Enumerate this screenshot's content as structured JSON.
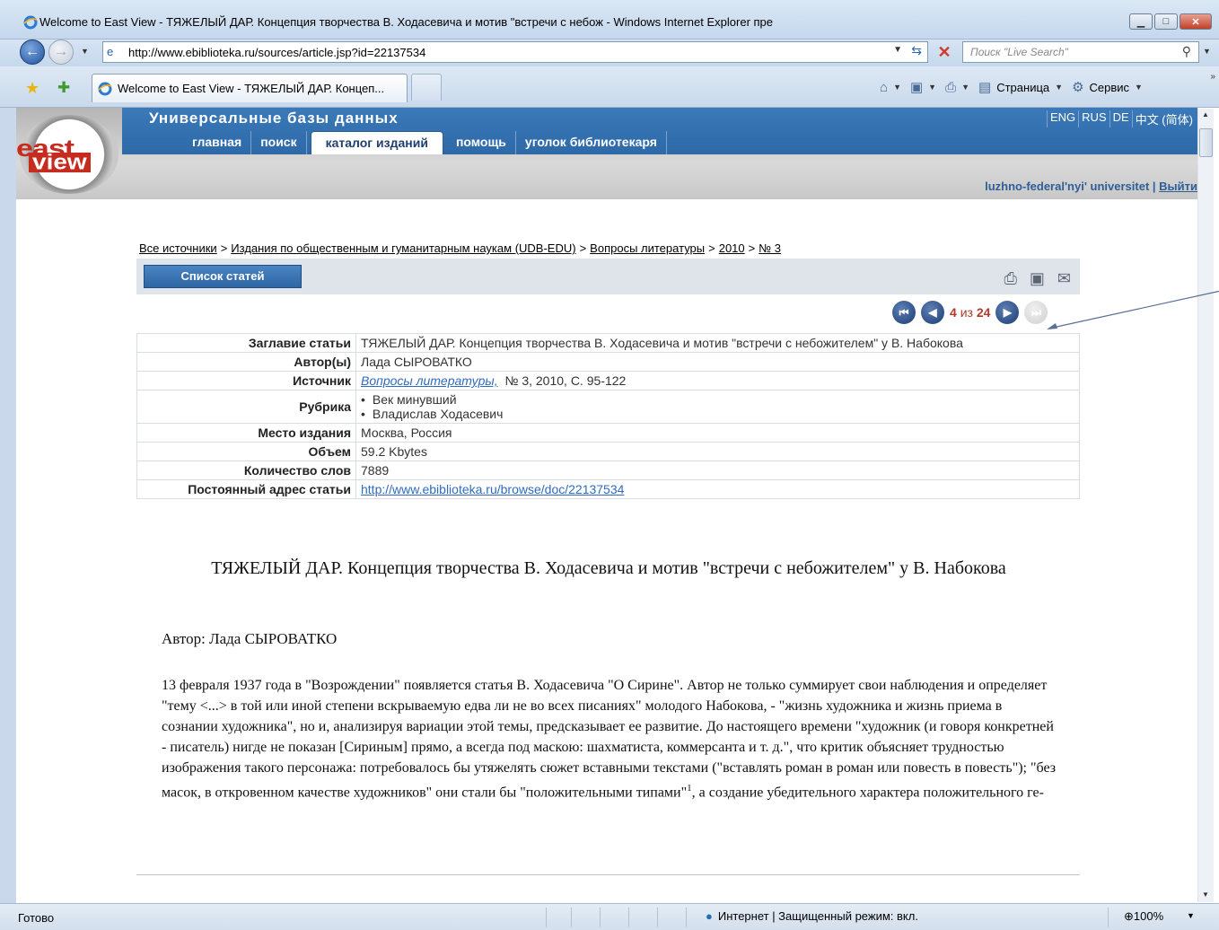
{
  "window": {
    "title": "Welcome to East View - ТЯЖЕЛЫЙ ДАР. Концепция творчества В. Ходасевича и мотив \"встречи с небож - Windows Internet Explorer пре",
    "address": "http://www.ebiblioteka.ru/sources/article.jsp?id=22137534",
    "search_placeholder": "Поиск \"Live Search\"",
    "tab_title": "Welcome to East View - ТЯЖЕЛЫЙ ДАР. Концеп...",
    "commands": {
      "page": "Страница",
      "tools": "Сервис"
    }
  },
  "site": {
    "title": "Универсальные базы данных",
    "languages": [
      "ENG",
      "RUS",
      "DE",
      "中文 (简体)"
    ],
    "nav": [
      "главная",
      "поиск",
      "каталог изданий",
      "помощь",
      "уголок библиотекаря"
    ],
    "active_nav": "каталог изданий",
    "user": "luzhno-federal'nyi' universitet",
    "logout": "Выйти",
    "logo": {
      "east": "east",
      "view": "view"
    }
  },
  "breadcrumb": [
    "Все источники",
    "Издания по общественным и гуманитарным наукам (UDB-EDU)",
    "Вопросы литературы",
    "2010",
    "№ 3"
  ],
  "toolbar": {
    "list_button": "Список статей"
  },
  "pager": {
    "current": "4",
    "of": "из",
    "total": "24"
  },
  "info": {
    "title_label": "Заглавие статьи",
    "title_value": "ТЯЖЕЛЫЙ ДАР. Концепция творчества В. Ходасевича и мотив \"встречи с небожителем\" у В. Набокова",
    "author_label": "Автор(ы)",
    "author_value": "Лада СЫРОВАТКО",
    "source_label": "Источник",
    "source_link": "Вопросы литературы,",
    "source_rest": "№ 3, 2010, C. 95-122",
    "rubric_label": "Рубрика",
    "rubric_items": [
      "Век минувший",
      "Владислав Ходасевич"
    ],
    "place_label": "Место издания",
    "place_value": "Москва, Россия",
    "volume_label": "Объем",
    "volume_value": "59.2 Kbytes",
    "words_label": "Количество слов",
    "words_value": "7889",
    "url_label": "Постоянный адрес статьи",
    "url_value": "http://www.ebiblioteka.ru/browse/doc/22137534"
  },
  "article": {
    "title": "ТЯЖЕЛЫЙ ДАР. Концепция творчества В. Ходасевича и мотив \"встречи с небожителем\" у В. Набокова",
    "author": "Автор: Лада СЫРОВАТКО",
    "body_before_sup": "13 февраля 1937 года в \"Возрождении\" появляется статья В. Ходасевича \"О Сирине\". Автор не только суммирует свои наблюдения и определяет \"тему <...> в той или иной степени вскрываемую едва ли не во всех писаниях\" молодого Набокова, - \"жизнь художника и жизнь приема в сознании художника\", но и, анализируя вариации этой темы, предсказывает ее развитие. До настоящего времени \"художник (и говоря конкретней - писатель) нигде не показан [Сириным] прямо, а всегда под маскою: шахматиста, коммерсанта и т. д.\", что критик объясняет трудностью изображения такого персонажа: потребовалось бы утяжелять сюжет вставными текстами (\"вставлять роман в роман или повесть в повесть\"); \"без масок, в откровенном качестве художников\" они стали бы \"положительными типами\"",
    "footnote": "1",
    "body_after_sup": ", а создание убедительного характера положительного ге-"
  },
  "status": {
    "ready": "Готово",
    "zone": "Интернет | Защищенный режим: вкл.",
    "zoom": "100%"
  }
}
